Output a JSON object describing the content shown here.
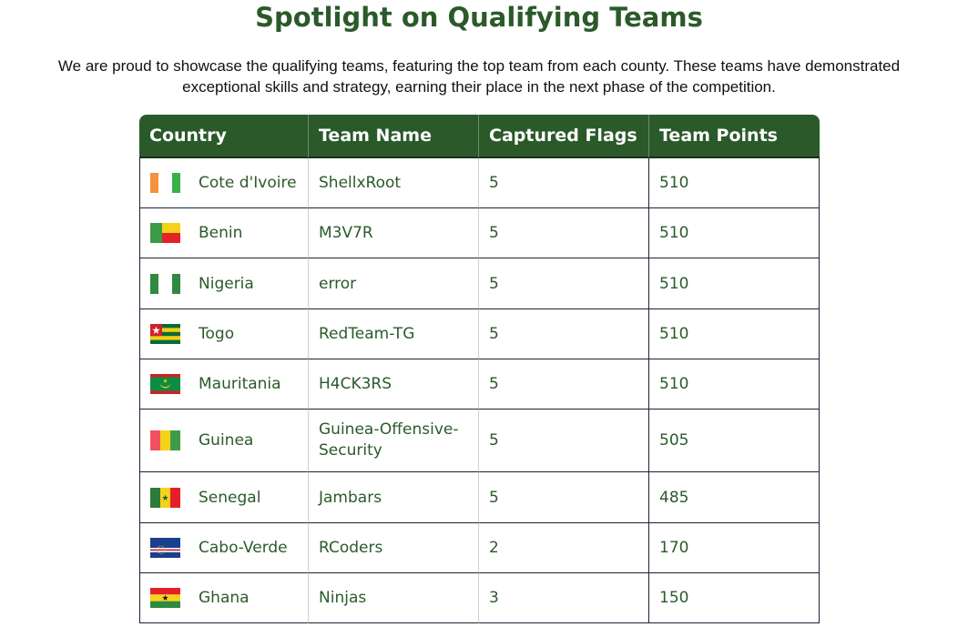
{
  "page": {
    "title": "Spotlight on Qualifying Teams",
    "intro_line1": "We are proud to showcase the qualifying teams, featuring the top team from each county. These teams have demonstrated",
    "intro_line2": "exceptional skills and strategy, earning their place in the next phase of the competition."
  },
  "table": {
    "headers": {
      "country": "Country",
      "team_name": "Team Name",
      "captured_flags": "Captured Flags",
      "team_points": "Team Points"
    },
    "rows": [
      {
        "country": "Cote d'Ivoire",
        "flag_icon": "cote-divoire-flag-icon",
        "team": "ShellxRoot",
        "flags": "5",
        "points": "510"
      },
      {
        "country": "Benin",
        "flag_icon": "benin-flag-icon",
        "team": "M3V7R",
        "flags": "5",
        "points": "510"
      },
      {
        "country": "Nigeria",
        "flag_icon": "nigeria-flag-icon",
        "team": "error",
        "flags": "5",
        "points": "510"
      },
      {
        "country": "Togo",
        "flag_icon": "togo-flag-icon",
        "team": "RedTeam-TG",
        "flags": "5",
        "points": "510"
      },
      {
        "country": "Mauritania",
        "flag_icon": "mauritania-flag-icon",
        "team": "H4CK3RS",
        "flags": "5",
        "points": "510"
      },
      {
        "country": "Guinea",
        "flag_icon": "guinea-flag-icon",
        "team_line1": "Guinea-Offensive-",
        "team_line2": "Security",
        "flags": "5",
        "points": "505"
      },
      {
        "country": "Senegal",
        "flag_icon": "senegal-flag-icon",
        "team": "Jambars",
        "flags": "5",
        "points": "485"
      },
      {
        "country": "Cabo-Verde",
        "flag_icon": "cabo-verde-flag-icon",
        "team": "RCoders",
        "flags": "2",
        "points": "170"
      },
      {
        "country": "Ghana",
        "flag_icon": "ghana-flag-icon",
        "team": "Ninjas",
        "flags": "3",
        "points": "150"
      }
    ]
  },
  "colors": {
    "brand_green": "#2b5a2a",
    "header_bg": "#2b5a2a",
    "border_dark": "#1a2336"
  }
}
